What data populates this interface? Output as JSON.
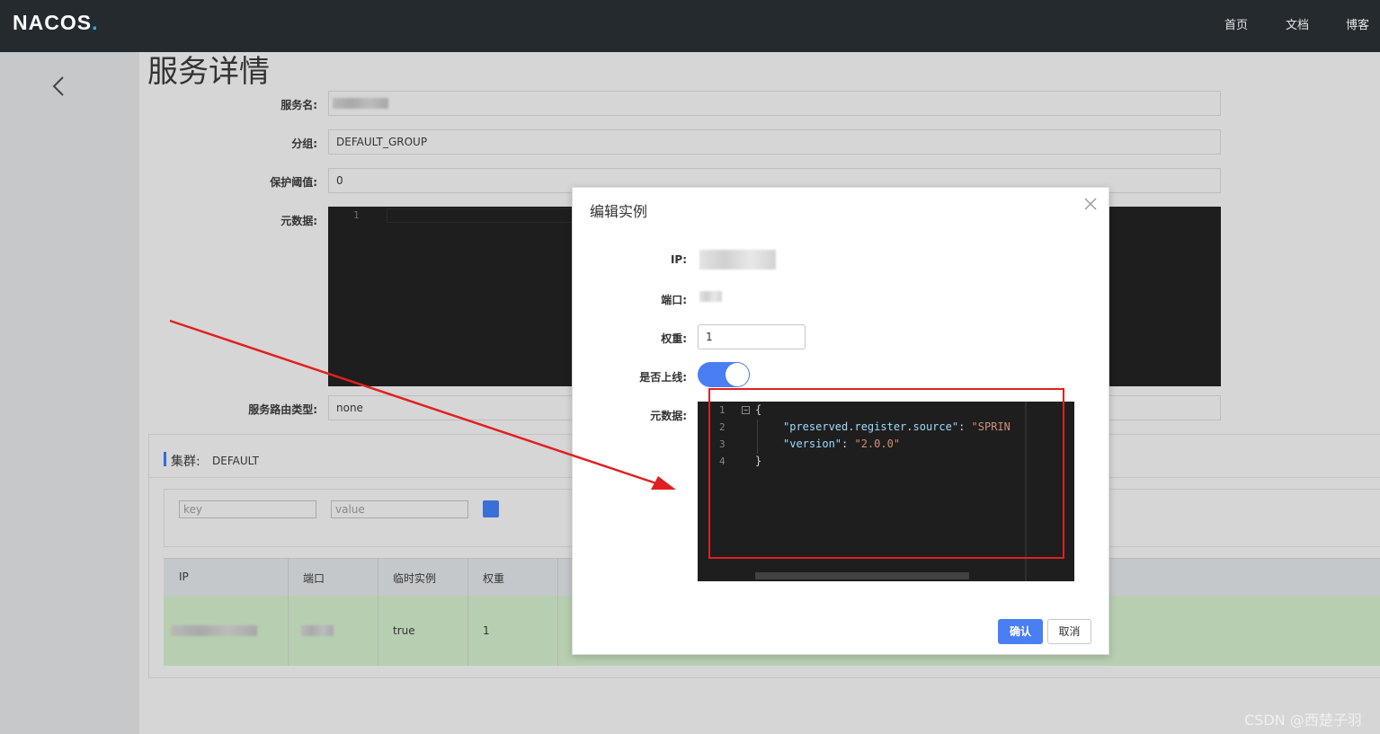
{
  "topbar": {
    "logo": "NACOS",
    "logo_dot": ".",
    "nav": [
      "首页",
      "文档",
      "博客"
    ]
  },
  "page": {
    "title": "服务详情"
  },
  "service_form": {
    "name_label": "服务名:",
    "group_label": "分组:",
    "group_value": "DEFAULT_GROUP",
    "threshold_label": "保护阈值:",
    "threshold_value": "0",
    "metadata_label": "元数据:",
    "metadata_line": "1",
    "selector_label": "服务路由类型:",
    "selector_value": "none"
  },
  "cluster": {
    "title": "集群:",
    "name": "DEFAULT",
    "key_placeholder": "key",
    "value_placeholder": "value",
    "columns": [
      "IP",
      "端口",
      "临时实例",
      "权重"
    ],
    "row": {
      "ephemeral": "true",
      "weight": "1"
    }
  },
  "modal": {
    "title": "编辑实例",
    "ip_label": "IP:",
    "port_label": "端口:",
    "weight_label": "权重:",
    "weight_value": "1",
    "online_label": "是否上线:",
    "online": true,
    "metadata_label": "元数据:",
    "code_line_numbers": [
      "1",
      "2",
      "3",
      "4"
    ],
    "code": {
      "open": "{",
      "key1": "\"preserved.register.source\"",
      "val1": "\"SPRIN",
      "key2": "\"version\"",
      "val2": "\"2.0.0\"",
      "close": "}"
    },
    "confirm_label": "确认",
    "cancel_label": "取消"
  },
  "colors": {
    "topbar": "#252a2f",
    "accent": "#4a7ef3",
    "highlight_row": "#b7cfb0",
    "annotation": "#e02020"
  },
  "watermark": "CSDN @西楚子羽"
}
